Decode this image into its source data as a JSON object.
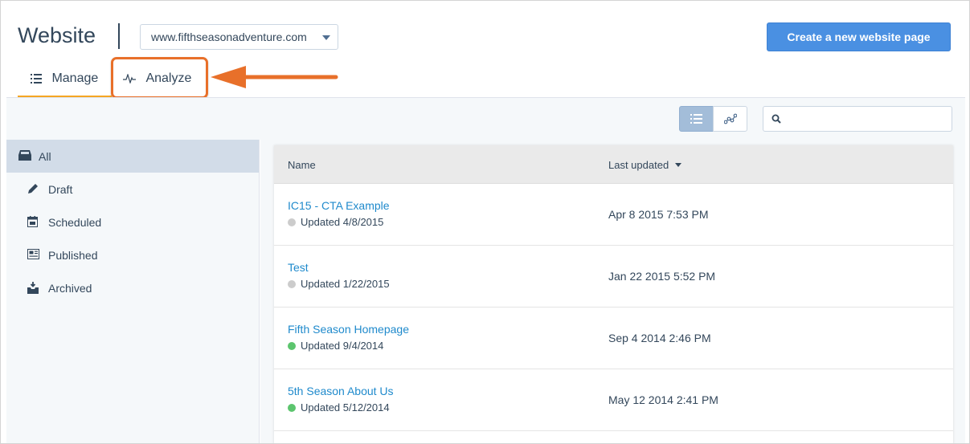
{
  "header": {
    "title": "Website",
    "domain_select": "www.fifthseasonadventure.com",
    "create_button": "Create a new website page"
  },
  "tabs": [
    {
      "label": "Manage",
      "icon": "list-icon",
      "active": true
    },
    {
      "label": "Analyze",
      "icon": "pulse-icon",
      "active": false
    }
  ],
  "toolbar": {
    "list_view_icon": "list-view-icon",
    "graph_view_icon": "graph-view-icon",
    "search_placeholder": "",
    "search_value": ""
  },
  "sidebar": {
    "items": [
      {
        "label": "All",
        "icon": "inbox-icon",
        "active": true
      },
      {
        "label": "Draft",
        "icon": "pencil-icon"
      },
      {
        "label": "Scheduled",
        "icon": "calendar-icon"
      },
      {
        "label": "Published",
        "icon": "newspaper-icon"
      },
      {
        "label": "Archived",
        "icon": "archive-box-icon"
      }
    ]
  },
  "table": {
    "columns": {
      "name": "Name",
      "last_updated": "Last updated"
    },
    "rows": [
      {
        "name": "IC15 - CTA Example",
        "status": "Updated 4/8/2015",
        "status_color": "#cccccc",
        "last_updated": "Apr 8 2015 7:53 PM"
      },
      {
        "name": "Test",
        "status": "Updated 1/22/2015",
        "status_color": "#cccccc",
        "last_updated": "Jan 22 2015 5:52 PM"
      },
      {
        "name": "Fifth Season Homepage",
        "status": "Updated 9/4/2014",
        "status_color": "#5cc56e",
        "last_updated": "Sep 4 2014 2:46 PM"
      },
      {
        "name": "5th Season About Us",
        "status": "Updated 5/12/2014",
        "status_color": "#5cc56e",
        "last_updated": "May 12 2014 2:41 PM"
      }
    ]
  },
  "colors": {
    "primary_button": "#4a90e2",
    "active_tab_underline": "#f5a623",
    "callout_orange": "#e8702a",
    "link": "#1f8acc"
  }
}
